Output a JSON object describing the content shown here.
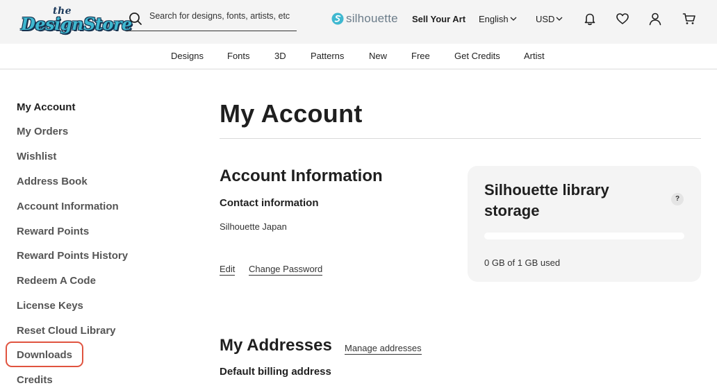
{
  "header": {
    "logo_small": "the",
    "logo_main": "DesignStore",
    "search_placeholder": "Search for designs, fonts, artists, etc",
    "silhouette_brand": "silhouette",
    "sell_your_art": "Sell Your Art",
    "language": "English",
    "currency": "USD",
    "icons": [
      "search-icon",
      "silhouette-logo-icon",
      "chevron-down-icon",
      "bell-icon",
      "heart-icon",
      "user-icon",
      "cart-icon"
    ]
  },
  "nav": {
    "items": [
      "Designs",
      "Fonts",
      "3D",
      "Patterns",
      "New",
      "Free",
      "Get Credits",
      "Artist"
    ]
  },
  "sidebar": {
    "items": [
      "My Account",
      "My Orders",
      "Wishlist",
      "Address Book",
      "Account Information",
      "Reward Points",
      "Reward Points History",
      "Redeem A Code",
      "License Keys",
      "Reset Cloud Library",
      "Downloads",
      "Credits"
    ],
    "active": "My Account",
    "highlighted": "Downloads"
  },
  "main": {
    "page_title": "My Account",
    "account_info": {
      "title": "Account Information",
      "contact_heading": "Contact information",
      "contact_name": "Silhouette Japan",
      "edit_link": "Edit",
      "change_password_link": "Change Password"
    },
    "storage": {
      "title": "Silhouette library storage",
      "help": "?",
      "used_fraction": 0,
      "usage_text": "0 GB of 1 GB used"
    },
    "addresses": {
      "title": "My Addresses",
      "manage_link": "Manage addresses",
      "billing_heading": "Default billing address"
    }
  },
  "colors": {
    "accent": "#3fb8d0",
    "highlight_outline": "#e0533f",
    "header_bg": "#f4f4f4",
    "card_bg": "#f4f4f4"
  }
}
